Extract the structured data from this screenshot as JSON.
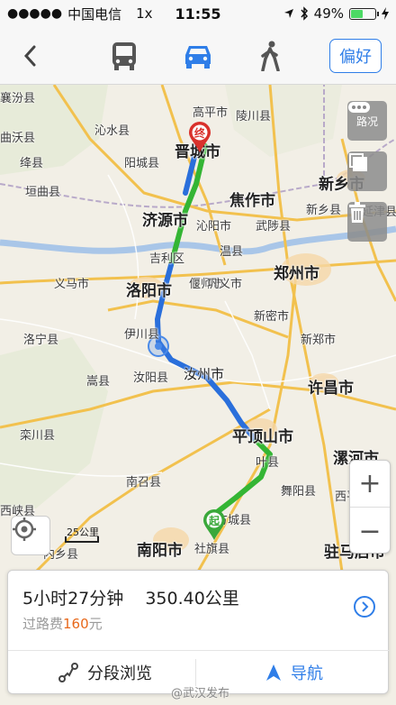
{
  "status_bar": {
    "carrier": "中国电信",
    "network": "1x",
    "time": "11:55",
    "battery": "49%",
    "signal_dots": "●●●●●"
  },
  "nav_bar": {
    "preferences_label": "偏好",
    "modes": [
      "bus-icon",
      "car-icon",
      "walk-icon"
    ],
    "active_mode": "car",
    "accent_color": "#2f7ee8"
  },
  "map": {
    "city_labels": {
      "jincheng": "晋城市",
      "jiaozuo": "焦作市",
      "jiyuan": "济源市",
      "xinxiang": "新乡市",
      "zhengzhou": "郑州市",
      "luoyang": "洛阳市",
      "xuchang": "许昌市",
      "pingdingshan": "平顶山市",
      "nanyang": "南阳市",
      "luohe": "漯河市",
      "zhumadian": "驻马店市"
    },
    "county_labels": {
      "yuanqu": "垣曲县",
      "qinshui": "沁水县",
      "yangcheng": "阳城县",
      "gaoping": "高平市",
      "lingchuan": "陵川县",
      "jiangxian": "绛县",
      "quwo": "曲沃县",
      "xiangfen": "襄汾县",
      "qinyang": "沁阳市",
      "wuzhi": "武陟县",
      "wenxian": "温县",
      "jili": "吉利区",
      "yima": "义马市",
      "yanshi": "偃师市",
      "gongyi": "巩义市",
      "xinmi": "新密市",
      "xinzheng": "新郑市",
      "luoning": "洛宁县",
      "yichuan": "伊川县",
      "ruyang": "汝阳县",
      "ruzhou": "汝州市",
      "songxian": "嵩县",
      "luanchuan": "栾川县",
      "nanzhao": "南召县",
      "fangcheng": "方城县",
      "yexian": "叶县",
      "wuyang": "舞阳县",
      "sheqi": "社旗县",
      "xixia": "西峡县",
      "neixiang": "内乡县",
      "xiping": "西平县",
      "xinxiangxian": "新乡县",
      "yanjin": "延津县"
    },
    "traffic_label": "路况",
    "start_marker": "起",
    "end_marker": "终",
    "scale_label": "25公里",
    "zoom_in": "+",
    "zoom_out": "−",
    "route_colors": {
      "slow": "#2a6fdb",
      "clear": "#34b534"
    }
  },
  "route_summary": {
    "duration": "5小时27分钟",
    "distance": "350.40公里",
    "toll_prefix": "过路费",
    "toll_amount": "160",
    "toll_unit": "元",
    "segment_view_label": "分段浏览",
    "navigate_label": "导航"
  },
  "watermark": "@武汉发布"
}
